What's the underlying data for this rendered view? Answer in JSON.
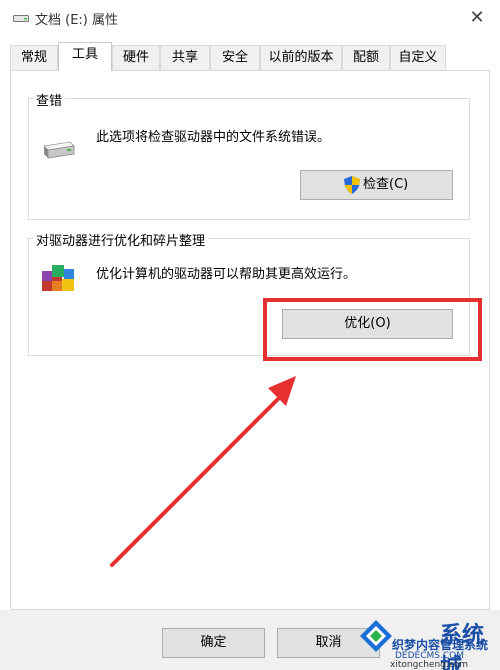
{
  "window": {
    "title": "文档 (E:) 属性",
    "close_glyph": "✕"
  },
  "tabs": [
    {
      "label": "常规",
      "active": false
    },
    {
      "label": "工具",
      "active": true
    },
    {
      "label": "硬件",
      "active": false
    },
    {
      "label": "共享",
      "active": false
    },
    {
      "label": "安全",
      "active": false
    },
    {
      "label": "以前的版本",
      "active": false
    },
    {
      "label": "配额",
      "active": false
    },
    {
      "label": "自定义",
      "active": false
    }
  ],
  "error_check": {
    "title": "查错",
    "description": "此选项将检查驱动器中的文件系统错误。",
    "button_label": "检查(C)"
  },
  "optimize": {
    "title": "对驱动器进行优化和碎片整理",
    "description": "优化计算机的驱动器可以帮助其更高效运行。",
    "button_label": "优化(O)"
  },
  "footer": {
    "ok_label": "确定",
    "cancel_label": "取消"
  },
  "watermark": {
    "brand": "系统城",
    "line1": "织梦内容管理系统",
    "line2": "DEDECMS.COM",
    "line3": "xitongcheng.com"
  },
  "colors": {
    "highlight": "#e63030",
    "arrow": "#e63030",
    "shield_blue": "#2a6ad8",
    "shield_yellow": "#f2c200"
  }
}
